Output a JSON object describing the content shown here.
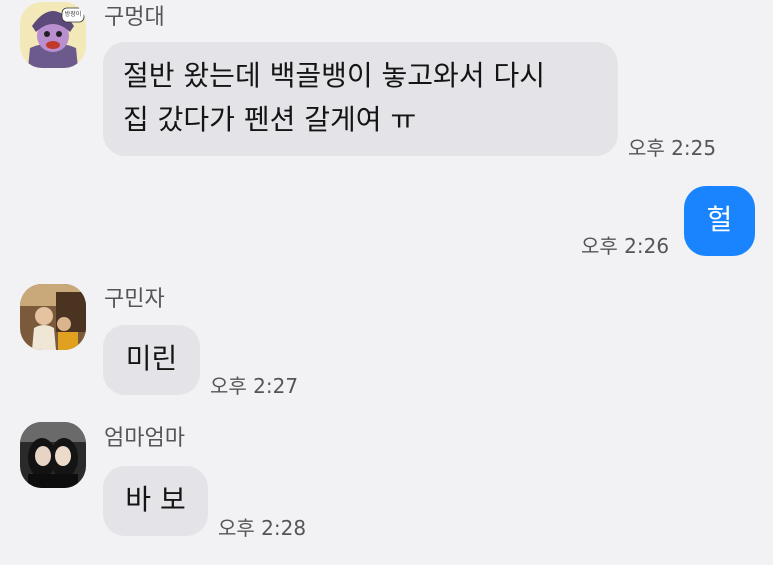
{
  "colors": {
    "background": "#f2f2f4",
    "incoming_bubble": "#e4e4e8",
    "outgoing_bubble": "#1a84ff",
    "meta_text": "#555558"
  },
  "messages": [
    {
      "sender": "구멍대",
      "avatar": "cartoon-character-avatar",
      "avatar_badge": "방장이",
      "text_lines": [
        "절반 왔는데 백골뱅이 놓고와서 다시",
        "집 갔다가 펜션 갈게여 ㅠ"
      ],
      "time": "오후 2:25",
      "direction": "incoming"
    },
    {
      "text_lines": [
        "헐"
      ],
      "time": "오후 2:26",
      "direction": "outgoing"
    },
    {
      "sender": "구민자",
      "avatar": "photo-avatar",
      "text_lines": [
        "미린"
      ],
      "time": "오후 2:27",
      "direction": "incoming"
    },
    {
      "sender": "엄마엄마",
      "avatar": "photo-avatar",
      "text_lines": [
        "바 보"
      ],
      "time": "오후 2:28",
      "direction": "incoming"
    }
  ]
}
